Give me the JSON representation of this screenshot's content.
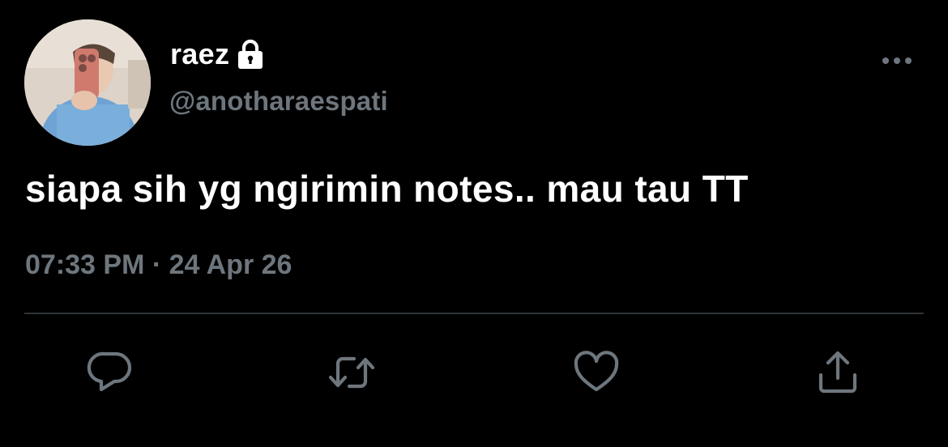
{
  "tweet": {
    "display_name": "raez",
    "handle": "@anotharaespati",
    "text": "siapa sih yg ngirimin notes.. mau tau TT",
    "timestamp": "07:33 PM · 24 Apr 26",
    "protected": true
  },
  "icons": {
    "avatar": "avatar-photo",
    "lock": "lock-icon",
    "more": "more-options-icon",
    "reply": "reply-icon",
    "retweet": "retweet-icon",
    "like": "like-icon",
    "share": "share-icon"
  },
  "colors": {
    "background": "#000000",
    "primary_text": "#ffffff",
    "secondary_text": "#6e767d",
    "divider": "#2f3336"
  }
}
